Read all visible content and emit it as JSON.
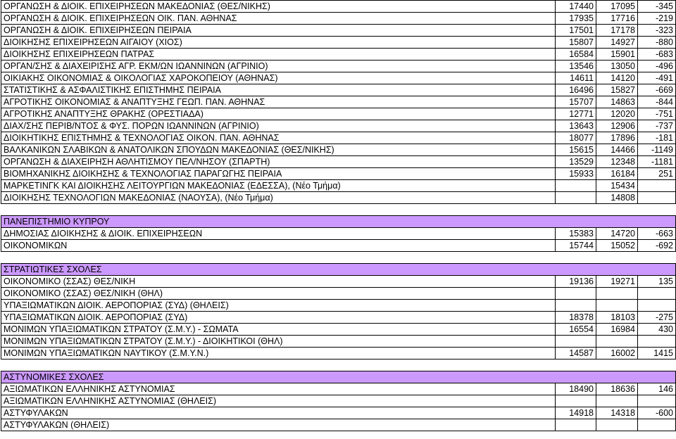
{
  "rows": [
    {
      "type": "data",
      "name": "ΟΡΓΑΝΩΣΗ & ΔΙΟΙΚ. ΕΠΙΧΕΙΡΗΣΕΩΝ ΜΑΚΕΔΟΝΙΑΣ (ΘΕΣ/ΝΙΚΗΣ)",
      "a": "17440",
      "b": "17095",
      "c": "-345"
    },
    {
      "type": "data",
      "name": "ΟΡΓΑΝΩΣΗ & ΔΙΟΙΚ. ΕΠΙΧΕΙΡΗΣΕΩΝ ΟΙΚ. ΠΑΝ. ΑΘΗΝΑΣ",
      "a": "17935",
      "b": "17716",
      "c": "-219"
    },
    {
      "type": "data",
      "name": "ΟΡΓΑΝΩΣΗ & ΔΙΟΙΚ. ΕΠΙΧΕΙΡΗΣΕΩΝ ΠΕΙΡΑΙΑ",
      "a": "17501",
      "b": "17178",
      "c": "-323"
    },
    {
      "type": "data",
      "name": "ΔΙΟΙΚΗΣΗΣ ΕΠΙΧΕΙΡΗΣΕΩΝ ΑΙΓΑΙΟΥ (ΧΙΟΣ)",
      "a": "15807",
      "b": "14927",
      "c": "-880"
    },
    {
      "type": "data",
      "name": "ΔΙΟΙΚΗΣΗΣ ΕΠΙΧΕΙΡΗΣΕΩΝ ΠΑΤΡΑΣ",
      "a": "16584",
      "b": "15901",
      "c": "-683"
    },
    {
      "type": "data",
      "name": "ΟΡΓΑΝ/ΣΗΣ & ΔΙΑΧΕΙΡΙΣΗΣ ΑΓΡ. ΕΚΜ/ΩΝ ΙΩΑΝΝΙΝΩΝ (ΑΓΡΙΝΙΟ)",
      "a": "13546",
      "b": "13050",
      "c": "-496"
    },
    {
      "type": "data",
      "name": "ΟΙΚΙΑΚΗΣ ΟΙΚΟΝΟΜΙΑΣ & ΟΙΚΟΛΟΓΙΑΣ ΧΑΡΟΚΟΠΕΙΟΥ (ΑΘΗΝΑΣ)",
      "a": "14611",
      "b": "14120",
      "c": "-491"
    },
    {
      "type": "data",
      "name": "ΣΤΑΤΙΣΤΙΚΗΣ & ΑΣΦΑΛΙΣΤΙΚΗΣ ΕΠΙΣΤΗΜΗΣ ΠΕΙΡΑΙΑ",
      "a": "16496",
      "b": "15827",
      "c": "-669"
    },
    {
      "type": "data",
      "name": "ΑΓΡΟΤΙΚΗΣ ΟΙΚΟΝΟΜΙΑΣ & ΑΝΑΠΤΥΞΗΣ ΓΕΩΠ. ΠΑΝ. ΑΘΗΝΑΣ",
      "a": "15707",
      "b": "14863",
      "c": "-844"
    },
    {
      "type": "data",
      "name": "ΑΓΡΟΤΙΚΗΣ ΑΝΑΠΤΥΞΗΣ ΘΡΑΚΗΣ (ΟΡΕΣΤΙΑΔΑ)",
      "a": "12771",
      "b": "12020",
      "c": "-751"
    },
    {
      "type": "data",
      "name": "ΔΙΑΧ/ΣΗΣ ΠΕΡΙΒ/ΝΤΟΣ & ΦΥΣ. ΠΟΡΩΝ ΙΩΑΝΝΙΝΩΝ (ΑΓΡΙΝΙΟ)",
      "a": "13643",
      "b": "12906",
      "c": "-737"
    },
    {
      "type": "data",
      "name": "ΔΙΟΙΚΗΤΙΚΗΣ ΕΠΙΣΤΗΜΗΣ & ΤΕΧΝΟΛΟΓΙΑΣ ΟΙΚΟΝ. ΠΑΝ. ΑΘΗΝΑΣ",
      "a": "18077",
      "b": "17896",
      "c": "-181"
    },
    {
      "type": "data",
      "name": "ΒΑΛΚΑΝΙΚΩΝ ΣΛΑΒΙΚΩΝ & ΑΝΑΤΟΛΙΚΩΝ ΣΠΟΥΔΩΝ ΜΑΚΕΔΟΝΙΑΣ (ΘΕΣ/ΝΙΚΗΣ)",
      "a": "15615",
      "b": "14466",
      "c": "-1149"
    },
    {
      "type": "data",
      "name": "ΟΡΓΑΝΩΣΗ & ΔΙΑΧΕΙΡΗΣΗ ΑΘΛΗΤΙΣΜΟΥ ΠΕΛ/ΝΗΣΟΥ (ΣΠΑΡΤΗ)",
      "a": "13529",
      "b": "12348",
      "c": "-1181"
    },
    {
      "type": "data",
      "name": "ΒΙΟΜΗΧΑΝΙΚΗΣ ΔΙΟΙΚΗΣΗΣ & ΤΕΧΝΟΛΟΓΙΑΣ ΠΑΡΑΓΩΓΗΣ ΠΕΙΡΑΙΑ",
      "a": "15933",
      "b": "16184",
      "c": "251"
    },
    {
      "type": "data",
      "name": "ΜΑΡΚΕΤΙΝΓΚ ΚΑΙ ΔΙΟΙΚΗΣΗΣ ΛΕΙΤΟΥΡΓΙΩΝ ΜΑΚΕΔΟΝΙΑΣ (ΕΔΕΣΣΑ), (Νέο Τμήμα)",
      "a": "",
      "b": "15434",
      "c": ""
    },
    {
      "type": "data",
      "name": "ΔΙΟΙΚΗΣΗΣ ΤΕΧΝΟΛΟΓΙΩΝ ΜΑΚΕΔΟΝΙΑΣ (ΝΑΟΥΣΑ), (Νέο Τμήμα)",
      "a": "",
      "b": "14808",
      "c": ""
    },
    {
      "type": "spacer"
    },
    {
      "type": "section",
      "name": "ΠΑΝΕΠΙΣΤΗΜΙΟ ΚΥΠΡΟΥ"
    },
    {
      "type": "data",
      "name": "ΔΗΜΟΣΙΑΣ ΔΙΟΙΚΗΣΗΣ & ΔΙΟΙΚ. ΕΠΙΧΕΙΡΗΣΕΩΝ",
      "a": "15383",
      "b": "14720",
      "c": "-663"
    },
    {
      "type": "data",
      "name": "ΟΙΚΟΝΟΜΙΚΩΝ",
      "a": "15744",
      "b": "15052",
      "c": "-692"
    },
    {
      "type": "spacer"
    },
    {
      "type": "section",
      "name": "ΣΤΡΑΤΙΩΤΙΚΕΣ ΣΧΟΛΕΣ"
    },
    {
      "type": "data",
      "name": "ΟΙΚΟΝΟΜΙΚΟ (ΣΣΑΣ) ΘΕΣ/ΝΙΚΗ",
      "a": "19136",
      "b": "19271",
      "c": "135"
    },
    {
      "type": "data",
      "name": "ΟΙΚΟΝΟΜΙΚΟ (ΣΣΑΣ) ΘΕΣ/ΝΙΚΗ (ΘΗΛ)",
      "a": "",
      "b": "",
      "c": ""
    },
    {
      "type": "data",
      "name": "ΥΠΑΞΙΩΜΑΤΙΚΩΝ ΔΙΟΙΚ. ΑΕΡΟΠΟΡΙΑΣ (ΣΥΔ) (ΘΗΛΕΙΣ)",
      "a": "",
      "b": "",
      "c": ""
    },
    {
      "type": "data",
      "name": "ΥΠΑΞΙΩΜΑΤΙΚΩΝ ΔΙΟΙΚ. ΑΕΡΟΠΟΡΙΑΣ (ΣΥΔ)",
      "a": "18378",
      "b": "18103",
      "c": "-275"
    },
    {
      "type": "data",
      "name": "ΜΟΝΙΜΩΝ ΥΠΑΞΙΩΜΑΤΙΚΩΝ ΣΤΡΑΤΟΥ (Σ.Μ.Υ.) - ΣΩΜΑΤΑ",
      "a": "16554",
      "b": "16984",
      "c": "430"
    },
    {
      "type": "data",
      "name": "ΜΟΝΙΜΩΝ ΥΠΑΞΙΩΜΑΤΙΚΩΝ ΣΤΡΑΤΟΥ (Σ.Μ.Υ.) - ΔΙΟΙΚΗΤΙΚΟΙ (ΘΗΛ)",
      "a": "",
      "b": "",
      "c": ""
    },
    {
      "type": "data",
      "name": "ΜΟΝΙΜΩΝ ΥΠΑΞΙΩΜΑΤΙΚΩΝ ΝΑΥΤΙΚΟΥ (Σ.Μ.Υ.Ν.)",
      "a": "14587",
      "b": "16002",
      "c": "1415"
    },
    {
      "type": "spacer"
    },
    {
      "type": "section",
      "name": "ΑΣΤΥΝΟΜΙΚΕΣ ΣΧΟΛΕΣ"
    },
    {
      "type": "data",
      "name": "ΑΞΙΩΜΑΤΙΚΩΝ ΕΛΛΗΝΙΚΗΣ ΑΣΤΥΝΟΜΙΑΣ",
      "a": "18490",
      "b": "18636",
      "c": "146"
    },
    {
      "type": "data",
      "name": "ΑΞΙΩΜΑΤΙΚΩΝ ΕΛΛΗΝΙΚΗΣ ΑΣΤΥΝΟΜΙΑΣ (ΘΗΛΕΙΣ)",
      "a": "",
      "b": "",
      "c": ""
    },
    {
      "type": "data",
      "name": "ΑΣΤΥΦΥΛΑΚΩΝ",
      "a": "14918",
      "b": "14318",
      "c": "-600"
    },
    {
      "type": "data",
      "name": "ΑΣΤΥΦΥΛΑΚΩΝ (ΘΗΛΕΙΣ)",
      "a": "",
      "b": "",
      "c": ""
    }
  ],
  "colors": {
    "section_fill": "#cc99ff",
    "grid": "#000000"
  }
}
